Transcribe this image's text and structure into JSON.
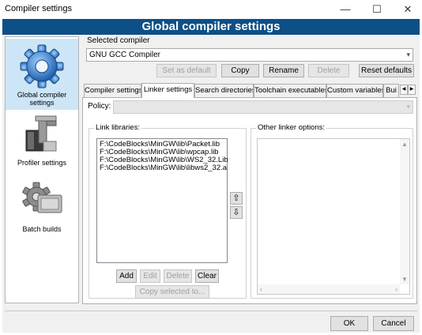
{
  "window": {
    "title": "Compiler settings",
    "minimize": "—",
    "maximize": "☐",
    "close": "✕"
  },
  "banner": {
    "title": "Global compiler settings"
  },
  "sidebar": {
    "items": [
      {
        "label": "Global compiler settings",
        "icon": "gear-icon",
        "selected": true
      },
      {
        "label": "Profiler settings",
        "icon": "profiler-icon"
      },
      {
        "label": "Batch builds",
        "icon": "batch-builds-icon"
      }
    ]
  },
  "compiler": {
    "group_label": "Selected compiler",
    "selected": "GNU GCC Compiler",
    "buttons": {
      "set_default": "Set as default",
      "copy": "Copy",
      "rename": "Rename",
      "delete": "Delete",
      "reset": "Reset defaults"
    }
  },
  "tabs": [
    {
      "label": "Compiler settings"
    },
    {
      "label": "Linker settings",
      "active": true
    },
    {
      "label": "Search directories"
    },
    {
      "label": "Toolchain executables"
    },
    {
      "label": "Custom variables"
    },
    {
      "label": "Bui"
    }
  ],
  "linker": {
    "policy_label": "Policy:",
    "policy_value": "",
    "link_libraries_label": "Link libraries:",
    "libraries": [
      "F:\\CodeBlocks\\MinGW\\lib\\Packet.lib",
      "F:\\CodeBlocks\\MinGW\\lib\\wpcap.lib",
      "F:\\CodeBlocks\\MinGW\\lib\\WS2_32.Lib",
      "F:\\CodeBlocks\\MinGW\\lib\\libws2_32.a"
    ],
    "move_up": "⇧",
    "move_down": "⇩",
    "buttons": {
      "add": "Add",
      "edit": "Edit",
      "delete": "Delete",
      "clear": "Clear",
      "copy_selected": "Copy selected to..."
    },
    "other_options_label": "Other linker options:",
    "other_options_value": ""
  },
  "footer": {
    "ok": "OK",
    "cancel": "Cancel"
  }
}
